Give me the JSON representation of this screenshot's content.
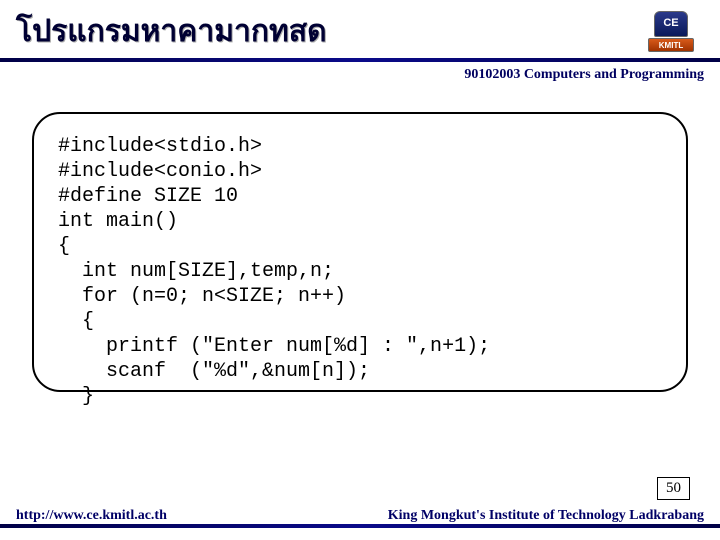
{
  "title": "โปรแกรมหาคามากทสด",
  "logo": {
    "top": "CE",
    "bottom": "KMITL"
  },
  "course": "90102003 Computers and Programming",
  "code_lines": [
    "#include<stdio.h>",
    "#include<conio.h>",
    "#define SIZE 10",
    "int main()",
    "{",
    "  int num[SIZE],temp,n;",
    "  for (n=0; n<SIZE; n++)",
    "  {",
    "    printf (\"Enter num[%d] : \",n+1);",
    "    scanf  (\"%d\",&num[n]);",
    "  }"
  ],
  "page_number": "50",
  "footer": {
    "url": "http://www.ce.kmitl.ac.th",
    "institute": "King Mongkut's Institute of Technology Ladkrabang"
  }
}
